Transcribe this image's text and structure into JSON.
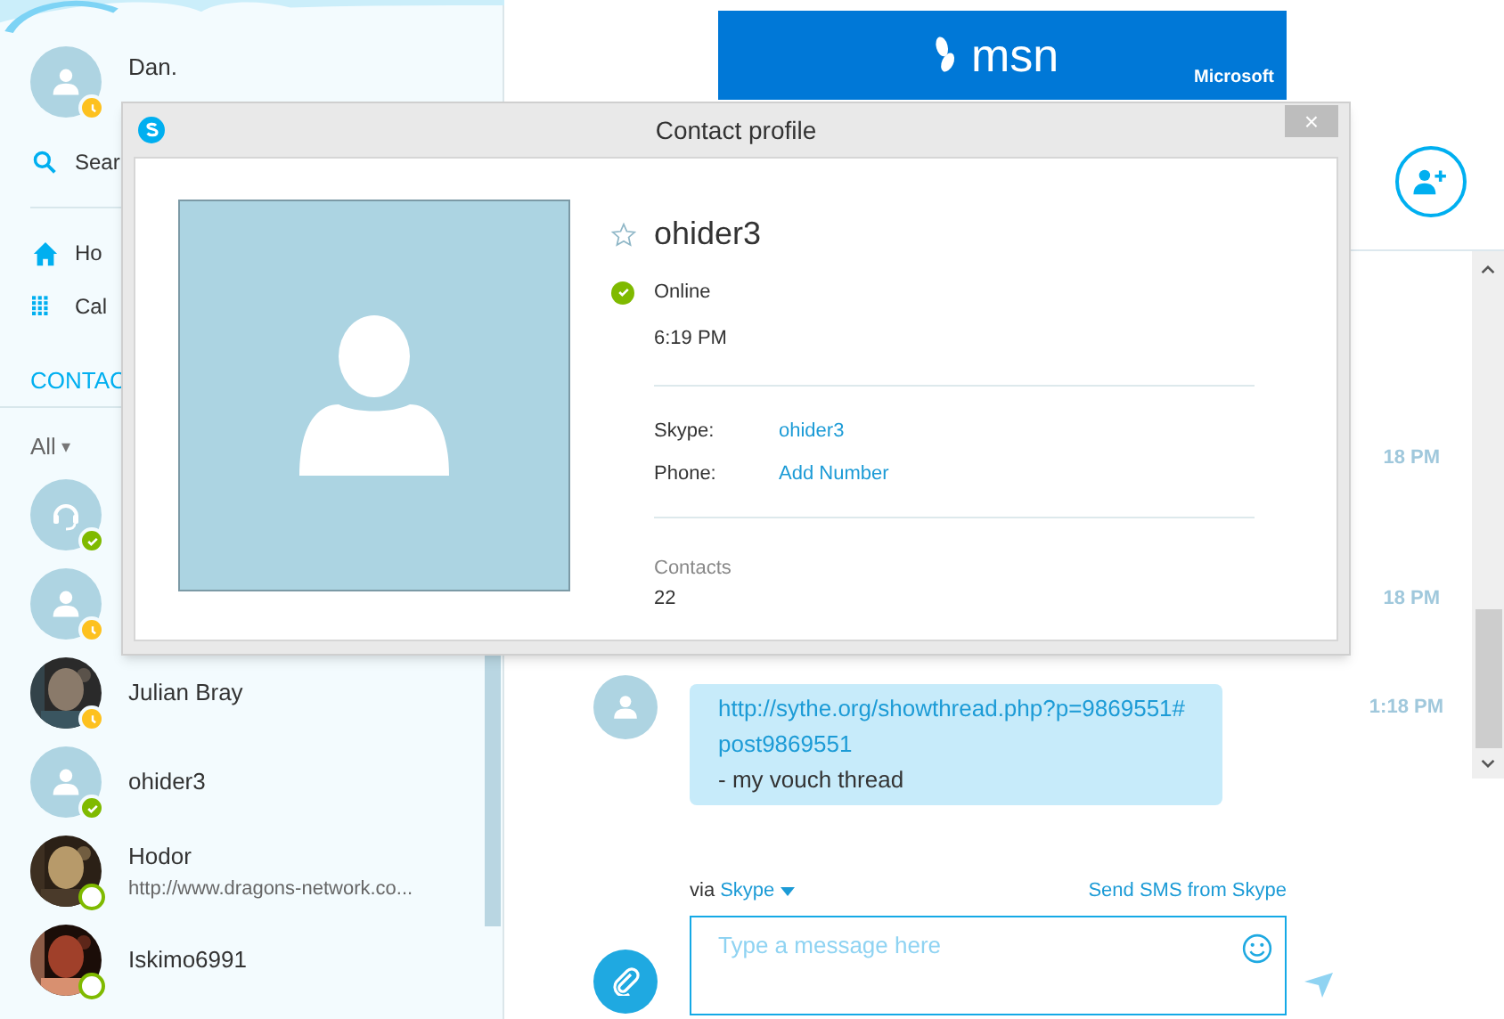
{
  "me": {
    "name": "Dan.",
    "status": {
      "kind": "away",
      "color": "#fdc11f"
    }
  },
  "nav": [
    {
      "kind": "search",
      "label": "Sear"
    },
    {
      "kind": "home",
      "label": "Ho"
    },
    {
      "kind": "calls",
      "label": "Cal"
    }
  ],
  "contacts_heading": "CONTAC",
  "filter": {
    "label": "All",
    "arrow": "▾"
  },
  "contacts": [
    {
      "kind": "headset",
      "status": {
        "kind": "online",
        "color": "#7fba00"
      }
    },
    {
      "kind": "person",
      "status": {
        "kind": "away",
        "color": "#fdc11f"
      }
    },
    {
      "kind": "picture",
      "status": {
        "kind": "away",
        "color": "#fdc11f"
      },
      "name": "Julian Bray"
    },
    {
      "kind": "person",
      "status": {
        "kind": "online",
        "color": "#7fba00"
      },
      "name": "ohider3"
    },
    {
      "kind": "picture",
      "status": {
        "kind": "mobile",
        "color": "#7fba00"
      },
      "name": "Hodor",
      "mood": "http://www.dragons-network.co..."
    },
    {
      "kind": "picture",
      "status": {
        "kind": "mobile",
        "color": "#7fba00"
      },
      "name": "Iskimo6991"
    }
  ],
  "ad": {
    "brand": "msn",
    "company": "Microsoft"
  },
  "messages": [
    {
      "time": "18 PM"
    },
    {
      "time": "18 PM"
    },
    {
      "time": "1:18 PM",
      "link": "http://sythe.org/showthread.php?p=9869551#post9869551",
      "text": " - my vouch thread"
    }
  ],
  "composer": {
    "via": "via",
    "service": "Skype",
    "sms": "Send SMS from Skype",
    "placeholder": "Type a message here"
  },
  "dialog": {
    "title": "Contact profile",
    "close": "×",
    "name": "ohider3",
    "favorite": false,
    "status": {
      "kind": "online",
      "color": "#7fba00"
    },
    "status_text": "Online",
    "local_time": "6:19 PM",
    "fields": [
      {
        "label": "Skype:",
        "value": "ohider3"
      },
      {
        "label": "Phone:",
        "value": "Add Number"
      }
    ],
    "contacts_label": "Contacts",
    "contacts_count": "22"
  }
}
